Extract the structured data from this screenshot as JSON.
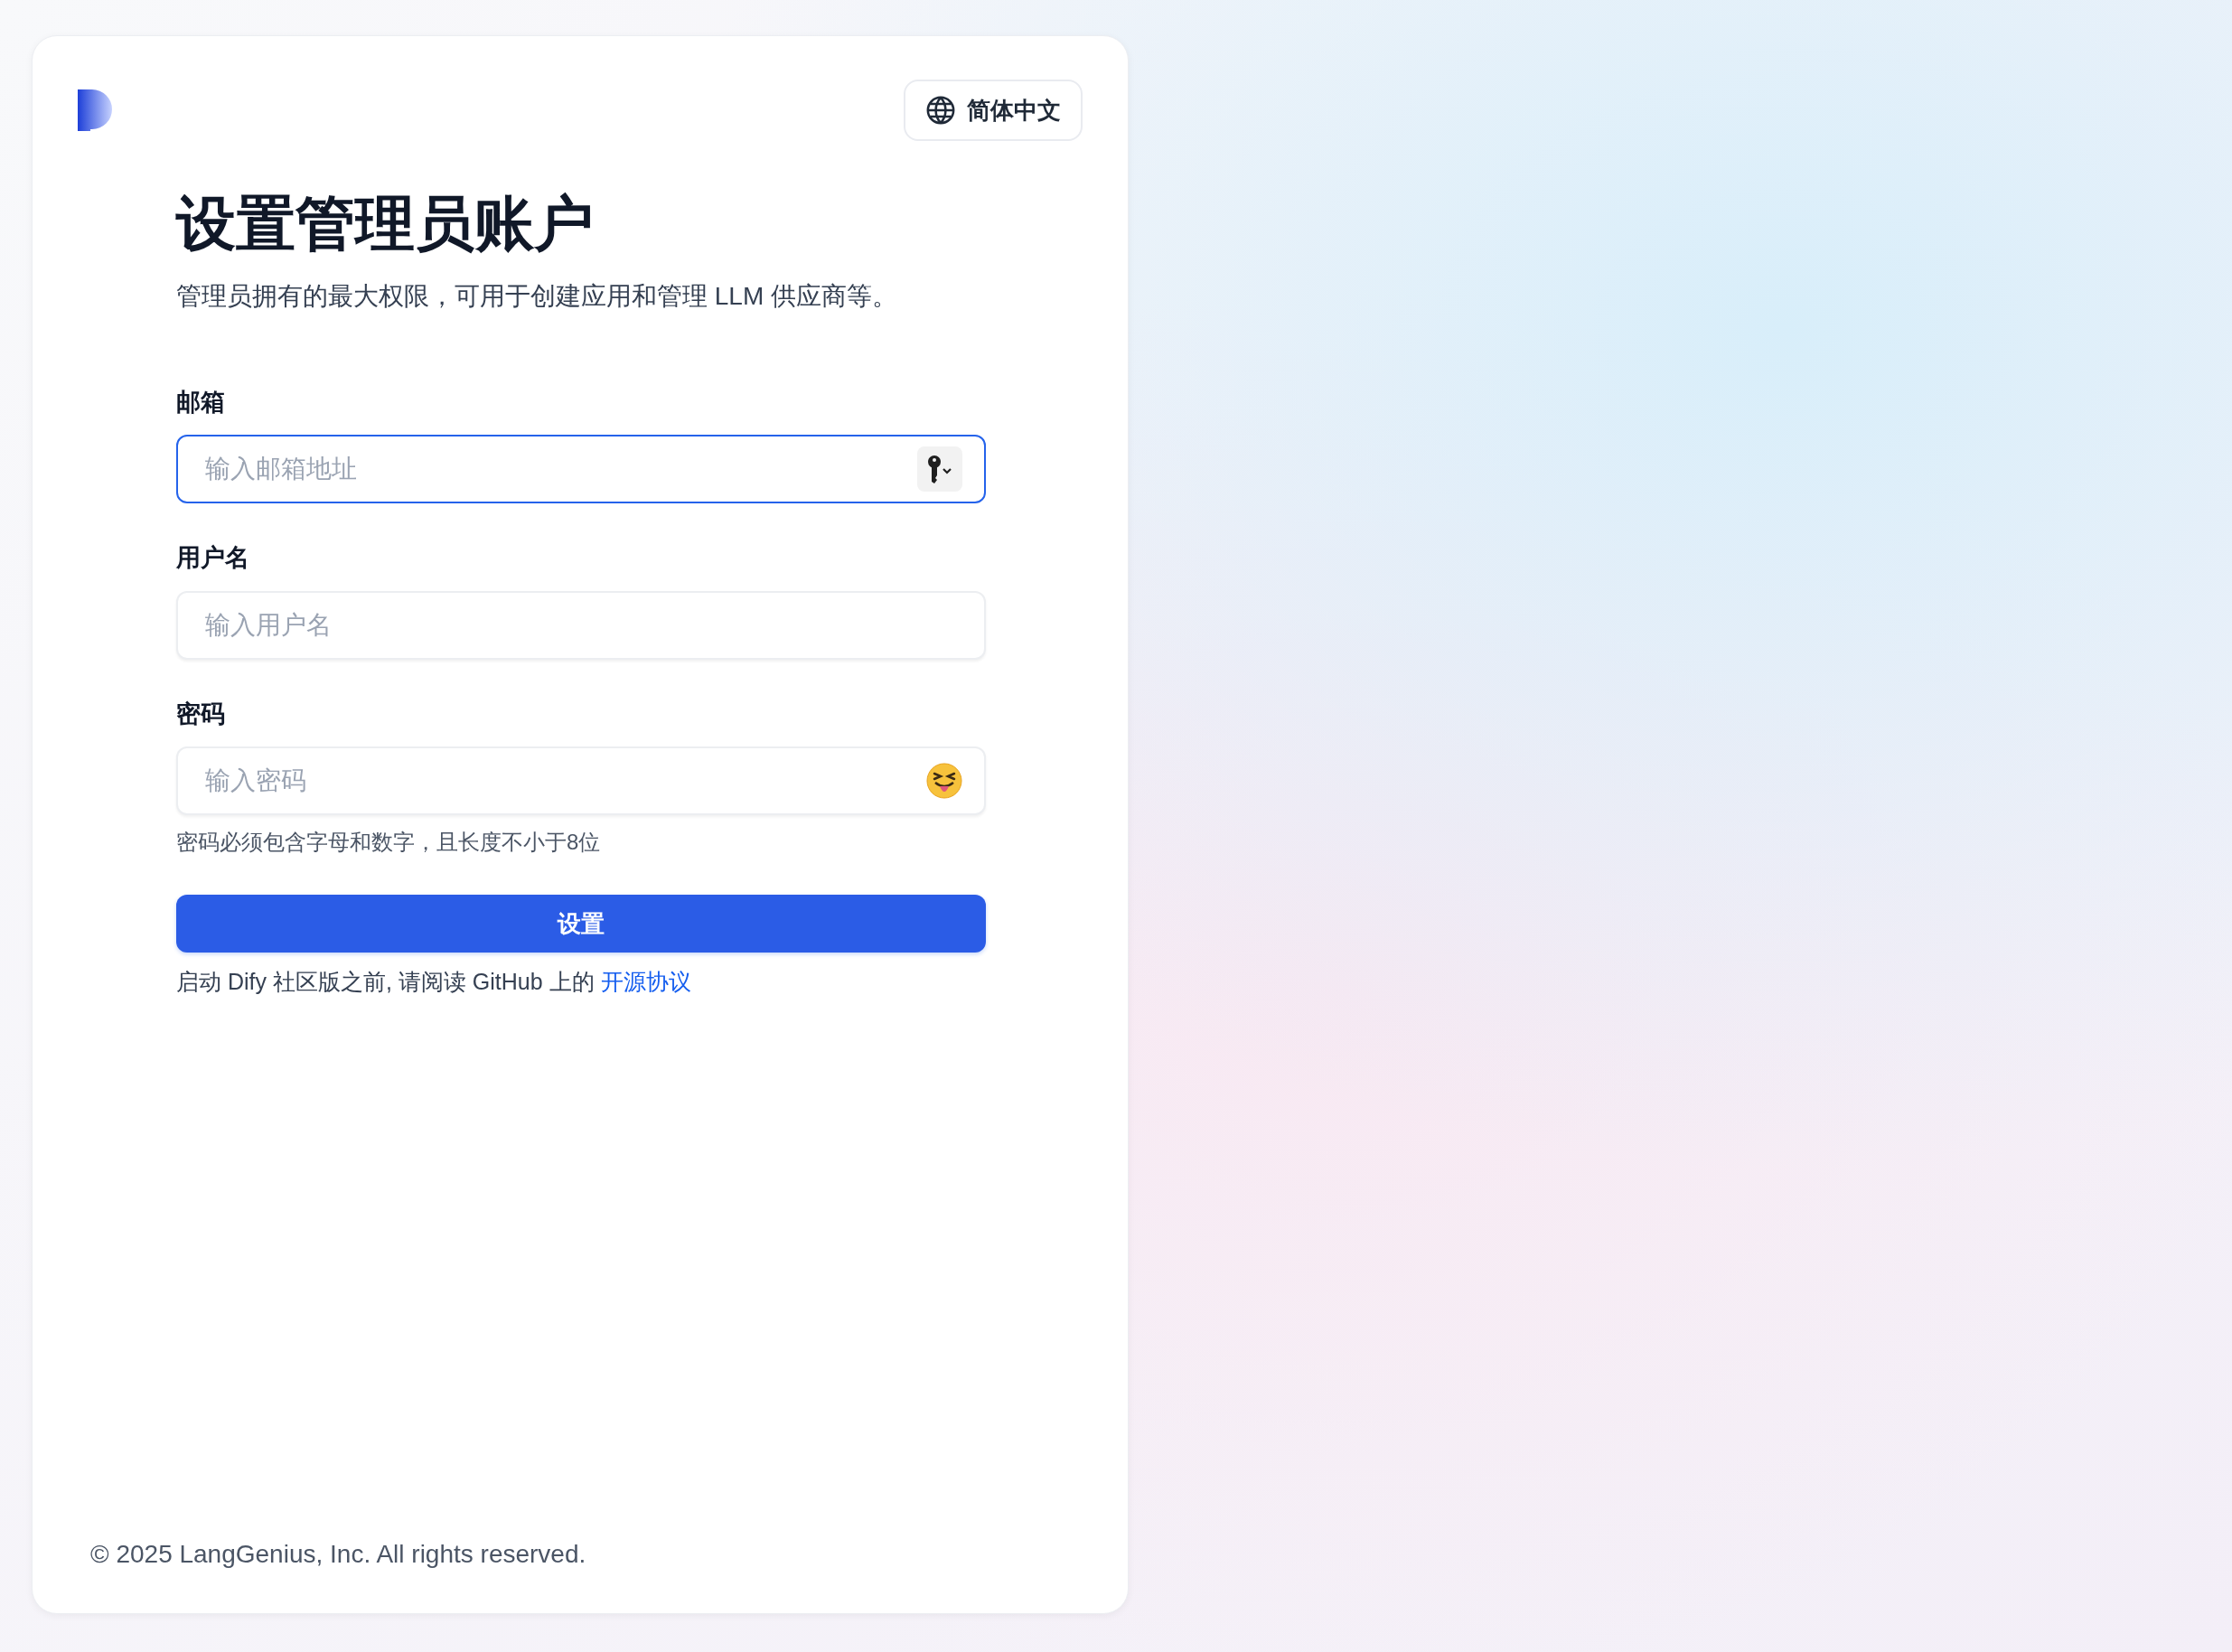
{
  "language_button": {
    "label": "简体中文"
  },
  "title": "设置管理员账户",
  "subtitle": "管理员拥有的最大权限，可用于创建应用和管理 LLM 供应商等。",
  "fields": [
    {
      "kind": "email",
      "label": "邮箱",
      "placeholder": "输入邮箱地址",
      "focused": true
    },
    {
      "kind": "text",
      "label": "用户名",
      "placeholder": "输入用户名",
      "focused": false
    },
    {
      "kind": "password",
      "label": "密码",
      "placeholder": "输入密码",
      "focused": false,
      "hint": "密码必须包含字母和数字，且长度不小于8位"
    }
  ],
  "submit_button": "设置",
  "notice": {
    "text": "启动 Dify 社区版之前, 请阅读 GitHub 上的",
    "link": "开源协议"
  },
  "footer": "© 2025 LangGenius, Inc. All rights reserved."
}
